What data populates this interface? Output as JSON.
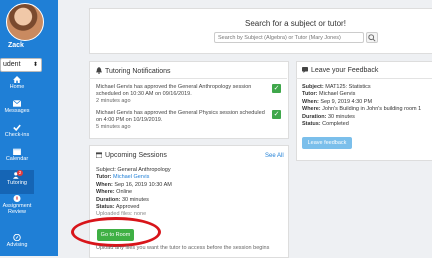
{
  "sidebar": {
    "user_name": "Zack",
    "role_select": "udent",
    "items": [
      {
        "label": "Home",
        "icon": "home-icon"
      },
      {
        "label": "Messages",
        "icon": "envelope-icon"
      },
      {
        "label": "Check-ins",
        "icon": "check-icon"
      },
      {
        "label": "Calendar",
        "icon": "calendar-icon"
      },
      {
        "label": "Tutoring",
        "icon": "users-icon",
        "badge": "2",
        "active": true
      },
      {
        "label": "Assignment Review",
        "icon": "document-icon"
      },
      {
        "label": "Advising",
        "icon": "compass-icon"
      }
    ]
  },
  "search": {
    "title": "Search for a subject or tutor!",
    "placeholder": "Search by Subject (Algebra) or Tutor (Mary Jones)"
  },
  "notifications": {
    "title": "Tutoring Notifications",
    "items": [
      {
        "text": "Michael Gervis has approved the General Anthropology session scheduled on 10:30 AM on 09/16/2019.",
        "ago": "2 minutes ago"
      },
      {
        "text": "Michael Gervis has approved the General Physics session scheduled on 4:00 PM on 10/19/2019.",
        "ago": "5 minutes ago"
      }
    ]
  },
  "upcoming": {
    "title": "Upcoming Sessions",
    "see_all": "See All",
    "subject_label": "Subject:",
    "subject": "General Anthropology",
    "tutor_label": "Tutor:",
    "tutor": "Michael Gervis",
    "when_label": "When:",
    "when": "Sep 16, 2019 10:30 AM",
    "where_label": "Where:",
    "where": "Online",
    "duration_label": "Duration:",
    "duration": "30 minutes",
    "status_label": "Status:",
    "status": "Approved",
    "partial_line": "Uploaded files: none",
    "go_button": "Go to Room",
    "footer": "Upload any files you want the tutor to access before the session begins"
  },
  "feedback": {
    "title": "Leave your Feedback",
    "subject_label": "Subject:",
    "subject": "MAT125: Statistics",
    "tutor_label": "Tutor:",
    "tutor": "Michael Gervis",
    "when_label": "When:",
    "when": "Sep 9, 2019 4:30 PM",
    "where_label": "Where:",
    "where": "John's Building in John's building room 1",
    "duration_label": "Duration:",
    "duration": "30 minutes",
    "status_label": "Status:",
    "status": "Completed",
    "button": "Leave feedback"
  },
  "colors": {
    "sidebar": "#1f7fd6",
    "success": "#3fb044",
    "annotation": "#d8151a"
  }
}
